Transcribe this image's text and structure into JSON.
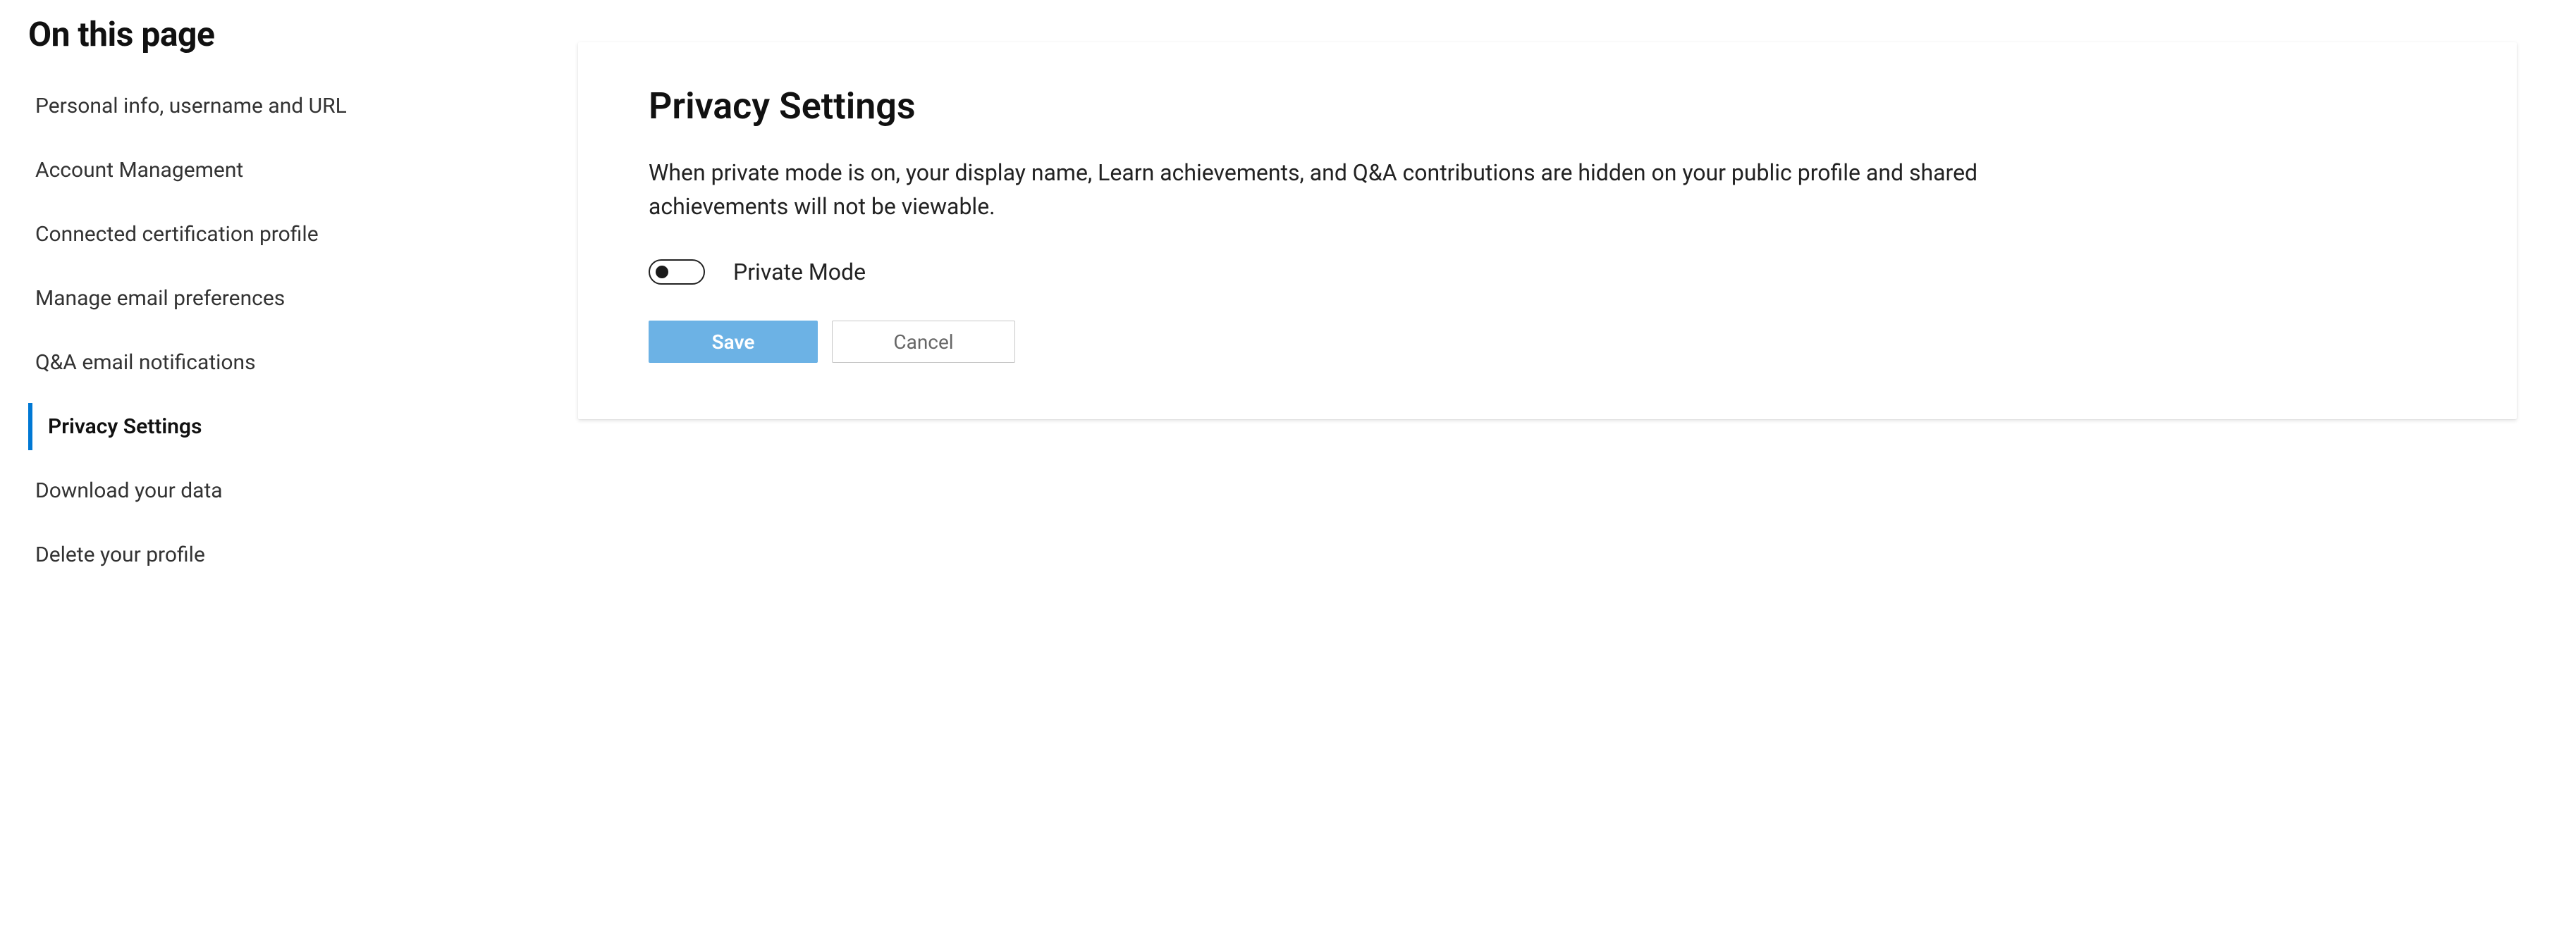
{
  "sidebar": {
    "title": "On this page",
    "items": [
      {
        "label": "Personal info, username and URL",
        "active": false
      },
      {
        "label": "Account Management",
        "active": false
      },
      {
        "label": "Connected certification profile",
        "active": false
      },
      {
        "label": "Manage email preferences",
        "active": false
      },
      {
        "label": "Q&A email notifications",
        "active": false
      },
      {
        "label": "Privacy Settings",
        "active": true
      },
      {
        "label": "Download your data",
        "active": false
      },
      {
        "label": "Delete your profile",
        "active": false
      }
    ]
  },
  "main": {
    "title": "Privacy Settings",
    "description": "When private mode is on, your display name, Learn achievements, and Q&A contributions are hidden on your public profile and shared achievements will not be viewable.",
    "toggle": {
      "label": "Private Mode",
      "checked": false
    },
    "buttons": {
      "save": "Save",
      "cancel": "Cancel"
    }
  }
}
